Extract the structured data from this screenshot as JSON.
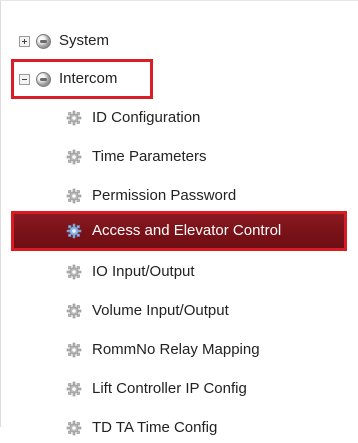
{
  "tree": {
    "system": {
      "label": "System",
      "toggle": "+",
      "icon": "globe-gear-icon"
    },
    "intercom": {
      "label": "Intercom",
      "toggle": "−",
      "icon": "globe-gear-icon",
      "items": [
        {
          "label": "ID Configuration",
          "icon": "gear-icon"
        },
        {
          "label": "Time Parameters",
          "icon": "gear-icon"
        },
        {
          "label": "Permission Password",
          "icon": "gear-icon"
        },
        {
          "label": "Access and Elevator Control",
          "icon": "gear-icon",
          "selected": true
        },
        {
          "label": "IO Input/Output",
          "icon": "gear-icon"
        },
        {
          "label": "Volume Input/Output",
          "icon": "gear-icon"
        },
        {
          "label": "RommNo Relay Mapping",
          "icon": "gear-icon"
        },
        {
          "label": "Lift Controller IP Config",
          "icon": "gear-icon"
        },
        {
          "label": "TD TA Time Config",
          "icon": "gear-icon"
        }
      ]
    }
  },
  "colors": {
    "highlight_border": "#d81f26",
    "selected_background": "#7a1218",
    "selected_text": "#ffffff"
  }
}
